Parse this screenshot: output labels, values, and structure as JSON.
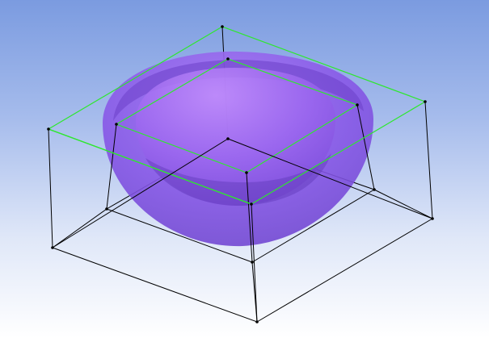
{
  "viewport": {
    "background_top": "#7b9be0",
    "background_bottom": "#ffffff"
  },
  "scene": {
    "shell_outer_color": "#8a55ea",
    "shell_inner_color": "#b27cf8",
    "shell_rim_color": "#6a3fc4",
    "selected_edge_color": "#2ee82e",
    "edge_color": "#000000",
    "vertex_color": "#000000"
  }
}
